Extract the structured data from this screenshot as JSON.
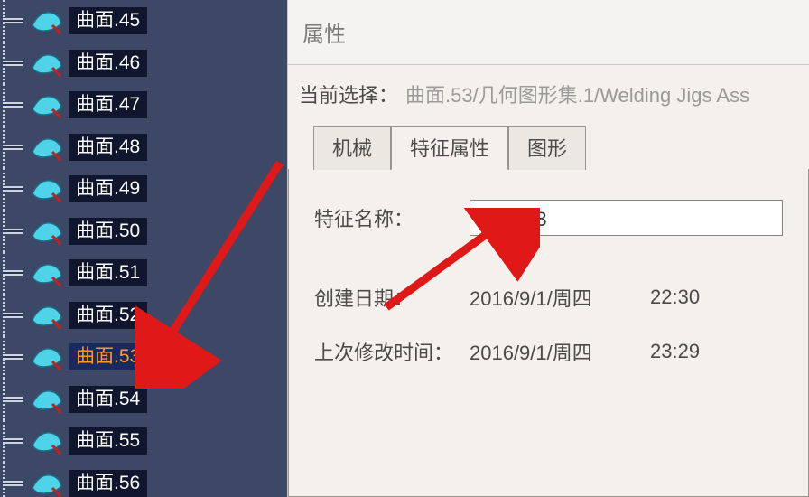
{
  "tree": {
    "items": [
      {
        "label": "曲面.45",
        "selected": false
      },
      {
        "label": "曲面.46",
        "selected": false
      },
      {
        "label": "曲面.47",
        "selected": false
      },
      {
        "label": "曲面.48",
        "selected": false
      },
      {
        "label": "曲面.49",
        "selected": false
      },
      {
        "label": "曲面.50",
        "selected": false
      },
      {
        "label": "曲面.51",
        "selected": false
      },
      {
        "label": "曲面.52",
        "selected": false
      },
      {
        "label": "曲面.53",
        "selected": true
      },
      {
        "label": "曲面.54",
        "selected": false
      },
      {
        "label": "曲面.55",
        "selected": false
      },
      {
        "label": "曲面.56",
        "selected": false
      }
    ]
  },
  "panel": {
    "title": "属性",
    "selection_label": "当前选择：",
    "selection_value": "曲面.53/几何图形集.1/Welding Jigs Ass",
    "tabs": {
      "mech": "机械",
      "feature": "特征属性",
      "graphic": "图形"
    },
    "feature_name_label": "特征名称：",
    "feature_name_value": "曲面.53",
    "created_label": "创建日期：",
    "created_date": "2016/9/1/周四",
    "created_time": "22:30",
    "modified_label": "上次修改时间：",
    "modified_date": "2016/9/1/周四",
    "modified_time": "23:29"
  }
}
